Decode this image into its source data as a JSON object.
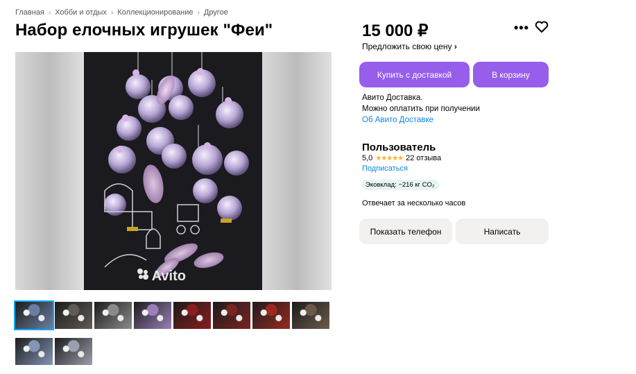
{
  "breadcrumb": [
    "Главная",
    "Хобби и отдых",
    "Коллекционирование",
    "Другое"
  ],
  "breadcrumb_sep": "›",
  "title": "Набор елочных игрушек \"Феи\"",
  "price": "15 000 ₽",
  "offer_price": "Предложить свою цену",
  "offer_chevron": "›",
  "more_icon": "•••",
  "buttons": {
    "buy_delivery": "Купить с доставкой",
    "to_cart": "В корзину",
    "show_phone": "Показать телефон",
    "write": "Написать"
  },
  "delivery": {
    "line1": "Авито Доставка.",
    "line2": "Можно оплатить при получении",
    "link": "Об Авито Доставке"
  },
  "seller": {
    "name": "Пользователь",
    "rating": "5,0",
    "stars": "★★★★★",
    "reviews": "22 отзыва",
    "subscribe": "Подписаться",
    "eco": "Эковклад: −216 кг CO₂",
    "reply_time": "Отвечает за несколько часов"
  },
  "watermark": "Avito",
  "colors": {
    "accent": "#965eeb",
    "link": "#0a86e6",
    "star": "#ffb021"
  },
  "thumbnails": [
    {
      "label": "photo 1",
      "tone": "#6a7fa0",
      "selected": true
    },
    {
      "label": "photo 2",
      "tone": "#5f5a55"
    },
    {
      "label": "photo 3",
      "tone": "#8b8b8b"
    },
    {
      "label": "photo 4",
      "tone": "#9a7fb8"
    },
    {
      "label": "photo 5",
      "tone": "#8a1d1d"
    },
    {
      "label": "photo 6",
      "tone": "#7a2323"
    },
    {
      "label": "photo 7",
      "tone": "#9a2a20"
    },
    {
      "label": "photo 8",
      "tone": "#6b5a4a"
    },
    {
      "label": "photo 9",
      "tone": "#8495b5"
    },
    {
      "label": "photo 10",
      "tone": "#9aa0ad"
    }
  ]
}
